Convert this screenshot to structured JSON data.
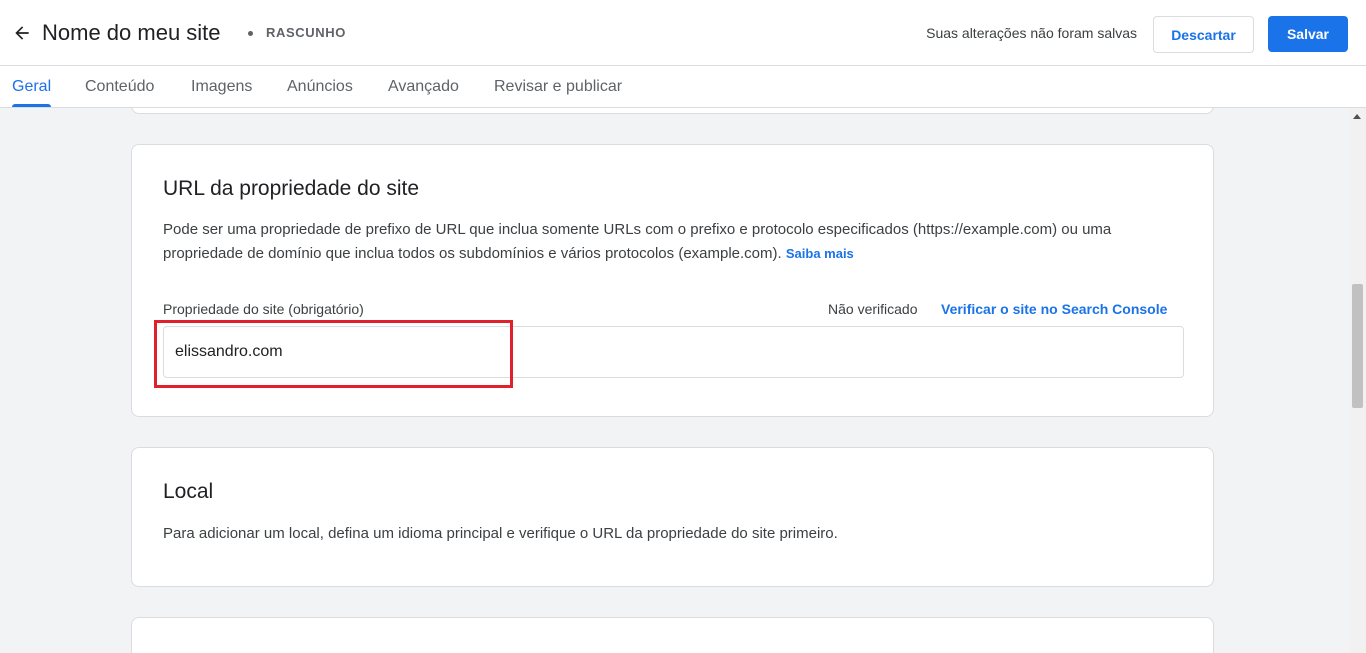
{
  "header": {
    "title": "Nome do meu site",
    "status": "RASCUNHO",
    "unsaved_message": "Suas alterações não foram salvas",
    "discard_label": "Descartar",
    "save_label": "Salvar"
  },
  "tabs": [
    {
      "label": "Geral",
      "active": true
    },
    {
      "label": "Conteúdo"
    },
    {
      "label": "Imagens"
    },
    {
      "label": "Anúncios"
    },
    {
      "label": "Avançado"
    },
    {
      "label": "Revisar e publicar"
    }
  ],
  "property_card": {
    "title": "URL da propriedade do site",
    "description": "Pode ser uma propriedade de prefixo de URL que inclua somente URLs com o prefixo e protocolo especificados (https://example.com) ou uma propriedade de domínio que inclua todos os subdomínios e vários protocolos (example.com).",
    "learn_more": "Saiba mais",
    "field_label": "Propriedade do site (obrigatório)",
    "verification_status": "Não verificado",
    "verify_link": "Verificar o site no Search Console",
    "field_value": "elissandro.com"
  },
  "local_card": {
    "title": "Local",
    "description": "Para adicionar um local, defina um idioma principal e verifique o URL da propriedade do site primeiro."
  },
  "colors": {
    "accent": "#1a73e8",
    "highlight": "#e0202a"
  }
}
